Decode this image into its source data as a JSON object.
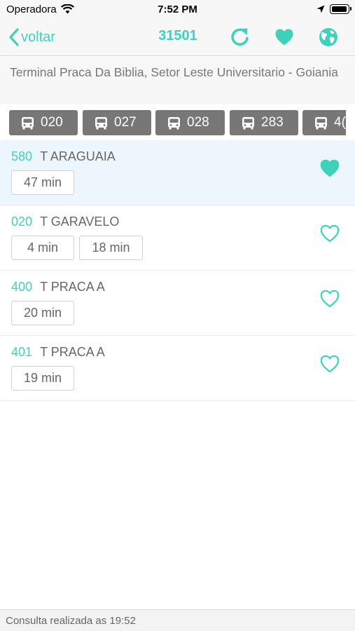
{
  "status_bar": {
    "carrier": "Operadora",
    "time": "7:52 PM"
  },
  "nav": {
    "back_label": "voltar",
    "title": "31501"
  },
  "stop": {
    "address": "Terminal Praca Da Biblia, Setor Leste Universitario - Goiania"
  },
  "line_chips": [
    "020",
    "027",
    "028",
    "283",
    "4("
  ],
  "arrivals": [
    {
      "line": "580",
      "destination": "T ARAGUAIA",
      "times": [
        "47 min"
      ],
      "favorite": true
    },
    {
      "line": "020",
      "destination": "T GARAVELO",
      "times": [
        "4 min",
        "18 min"
      ],
      "favorite": false
    },
    {
      "line": "400",
      "destination": "T PRACA A",
      "times": [
        "20 min"
      ],
      "favorite": false
    },
    {
      "line": "401",
      "destination": "T PRACA A",
      "times": [
        "19 min"
      ],
      "favorite": false
    }
  ],
  "footer": {
    "text": "Consulta realizada as 19:52"
  },
  "colors": {
    "accent": "#3fd2bb",
    "chip_bg": "#777777",
    "highlight_row": "#eef6fd"
  },
  "icons": {
    "back": "chevron-left-icon",
    "refresh": "refresh-icon",
    "favorite": "heart-icon",
    "map": "globe-icon",
    "chip": "bus-icon"
  }
}
